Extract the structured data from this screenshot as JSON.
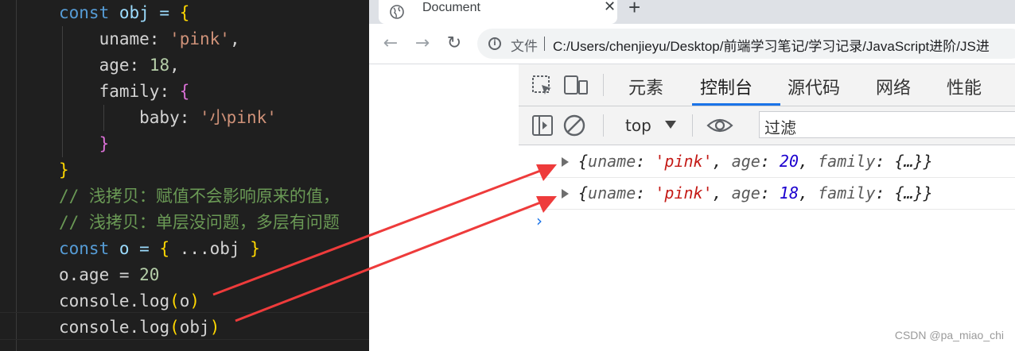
{
  "editor": {
    "lines": [
      {
        "tokens": [
          {
            "t": "const",
            "c": "kw"
          },
          {
            "t": " obj = ",
            "c": "prop"
          },
          {
            "t": "{",
            "c": "b1"
          }
        ]
      },
      {
        "tokens": [
          {
            "t": "    uname",
            "c": "plain"
          },
          {
            "t": ": ",
            "c": "plain"
          },
          {
            "t": "'pink'",
            "c": "str"
          },
          {
            "t": ",",
            "c": "plain"
          }
        ]
      },
      {
        "tokens": [
          {
            "t": "    age",
            "c": "plain"
          },
          {
            "t": ": ",
            "c": "plain"
          },
          {
            "t": "18",
            "c": "num"
          },
          {
            "t": ",",
            "c": "plain"
          }
        ]
      },
      {
        "tokens": [
          {
            "t": "    family",
            "c": "plain"
          },
          {
            "t": ": ",
            "c": "plain"
          },
          {
            "t": "{",
            "c": "b2"
          }
        ]
      },
      {
        "tokens": [
          {
            "t": "        baby",
            "c": "plain"
          },
          {
            "t": ": ",
            "c": "plain"
          },
          {
            "t": "'小pink'",
            "c": "str"
          }
        ]
      },
      {
        "tokens": [
          {
            "t": "    }",
            "c": "b2"
          }
        ]
      },
      {
        "tokens": [
          {
            "t": "}",
            "c": "b1"
          }
        ]
      },
      {
        "tokens": [
          {
            "t": "// 浅拷贝：赋值不会影响原来的值，",
            "c": "cmt"
          }
        ]
      },
      {
        "tokens": [
          {
            "t": "// 浅拷贝：单层没问题，多层有问题",
            "c": "cmt"
          }
        ]
      },
      {
        "tokens": [
          {
            "t": "const",
            "c": "kw"
          },
          {
            "t": " o = ",
            "c": "prop"
          },
          {
            "t": "{",
            "c": "b1"
          },
          {
            "t": " ...obj ",
            "c": "plain"
          },
          {
            "t": "}",
            "c": "b1"
          }
        ]
      },
      {
        "tokens": [
          {
            "t": "o.age",
            "c": "plain"
          },
          {
            "t": " = ",
            "c": "plain"
          },
          {
            "t": "20",
            "c": "num"
          }
        ]
      },
      {
        "tokens": [
          {
            "t": "console",
            "c": "plain"
          },
          {
            "t": ".",
            "c": "plain"
          },
          {
            "t": "log",
            "c": "plain"
          },
          {
            "t": "(",
            "c": "b1"
          },
          {
            "t": "o",
            "c": "plain"
          },
          {
            "t": ")",
            "c": "b1"
          }
        ]
      },
      {
        "tokens": [
          {
            "t": "console",
            "c": "plain"
          },
          {
            "t": ".",
            "c": "plain"
          },
          {
            "t": "log",
            "c": "plain"
          },
          {
            "t": "(",
            "c": "b1"
          },
          {
            "t": "obj",
            "c": "plain"
          },
          {
            "t": ")",
            "c": "b1"
          }
        ]
      }
    ]
  },
  "browser": {
    "tab_title": "Document",
    "tab_close": "✕",
    "new_tab": "+",
    "back": "←",
    "forward": "→",
    "reload": "↻",
    "info_icon": "i",
    "scheme_label": "文件",
    "url": "C:/Users/chenjieyu/Desktop/前端学习笔记/学习记录/JavaScript进阶/JS进"
  },
  "devtools": {
    "tabs": [
      {
        "label": "元素"
      },
      {
        "label": "控制台",
        "active": true
      },
      {
        "label": "源代码"
      },
      {
        "label": "网络"
      },
      {
        "label": "性能"
      }
    ],
    "context": "top",
    "filter_placeholder": "过滤",
    "logs": [
      {
        "uname": "'pink'",
        "age": "20",
        "family": "{…}"
      },
      {
        "uname": "'pink'",
        "age": "18",
        "family": "{…}"
      }
    ],
    "prompt": "›",
    "accent_color": "#1a73e8"
  },
  "annotation": {
    "arrow_color": "#ee3b3b"
  },
  "watermark": "CSDN @pa_miao_chi"
}
